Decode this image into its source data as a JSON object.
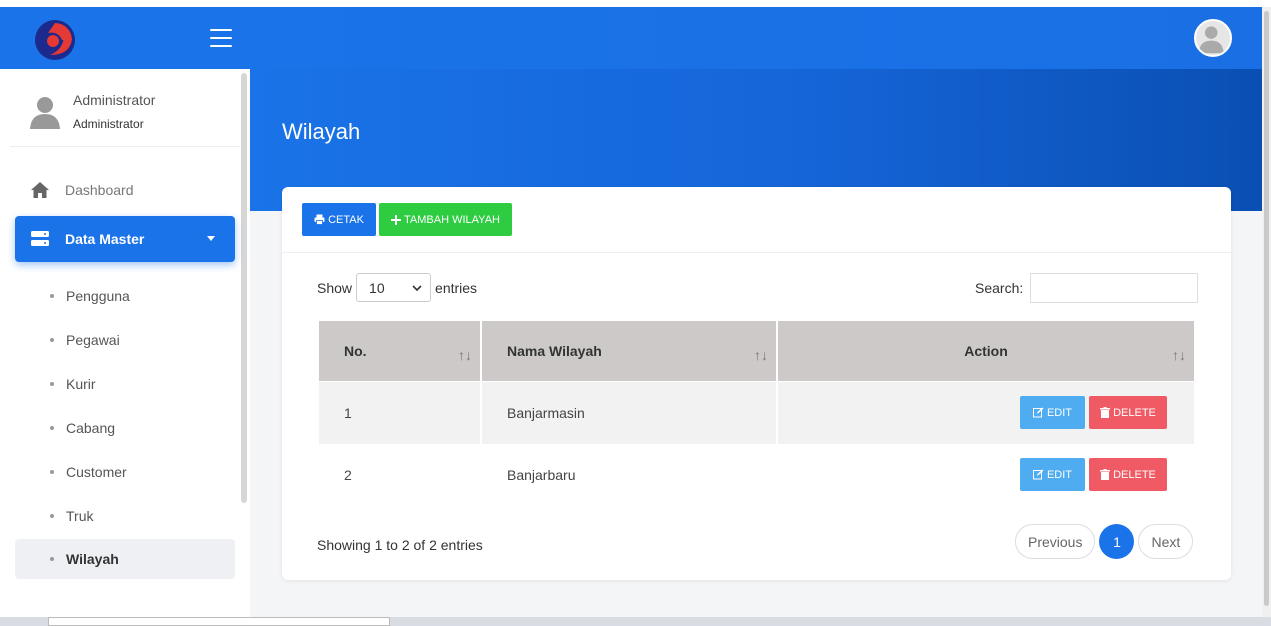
{
  "topbar": {
    "menu_icon": "hamburger-icon",
    "avatar_icon": "user-avatar-icon"
  },
  "sidebar": {
    "user_name": "Administrator",
    "user_role": "Administrator",
    "dashboard_label": "Dashboard",
    "master_label": "Data Master",
    "items": [
      {
        "label": "Pengguna"
      },
      {
        "label": "Pegawai"
      },
      {
        "label": "Kurir"
      },
      {
        "label": "Cabang"
      },
      {
        "label": "Customer"
      },
      {
        "label": "Truk"
      },
      {
        "label": "Wilayah"
      }
    ],
    "active_item": "Wilayah"
  },
  "page": {
    "title": "Wilayah"
  },
  "toolbar": {
    "cetak_label": "CETAK",
    "tambah_label": "TAMBAH WILAYAH"
  },
  "table_controls": {
    "show_label": "Show",
    "entries_value": "10",
    "entries_label": "entries",
    "search_label": "Search:"
  },
  "table": {
    "columns": [
      "No.",
      "Nama Wilayah",
      "Action"
    ],
    "rows": [
      {
        "no": "1",
        "nama": "Banjarmasin",
        "edit": "EDIT",
        "delete": "DELETE"
      },
      {
        "no": "2",
        "nama": "Banjarbaru",
        "edit": "EDIT",
        "delete": "DELETE"
      }
    ]
  },
  "footer": {
    "info": "Showing 1 to 2 of 2 entries",
    "previous": "Previous",
    "current_page": "1",
    "next": "Next"
  },
  "colors": {
    "primary": "#1a73e8",
    "success": "#2ecc40",
    "info": "#4facf0",
    "danger": "#f05a64",
    "header": "#cdc9c9"
  }
}
